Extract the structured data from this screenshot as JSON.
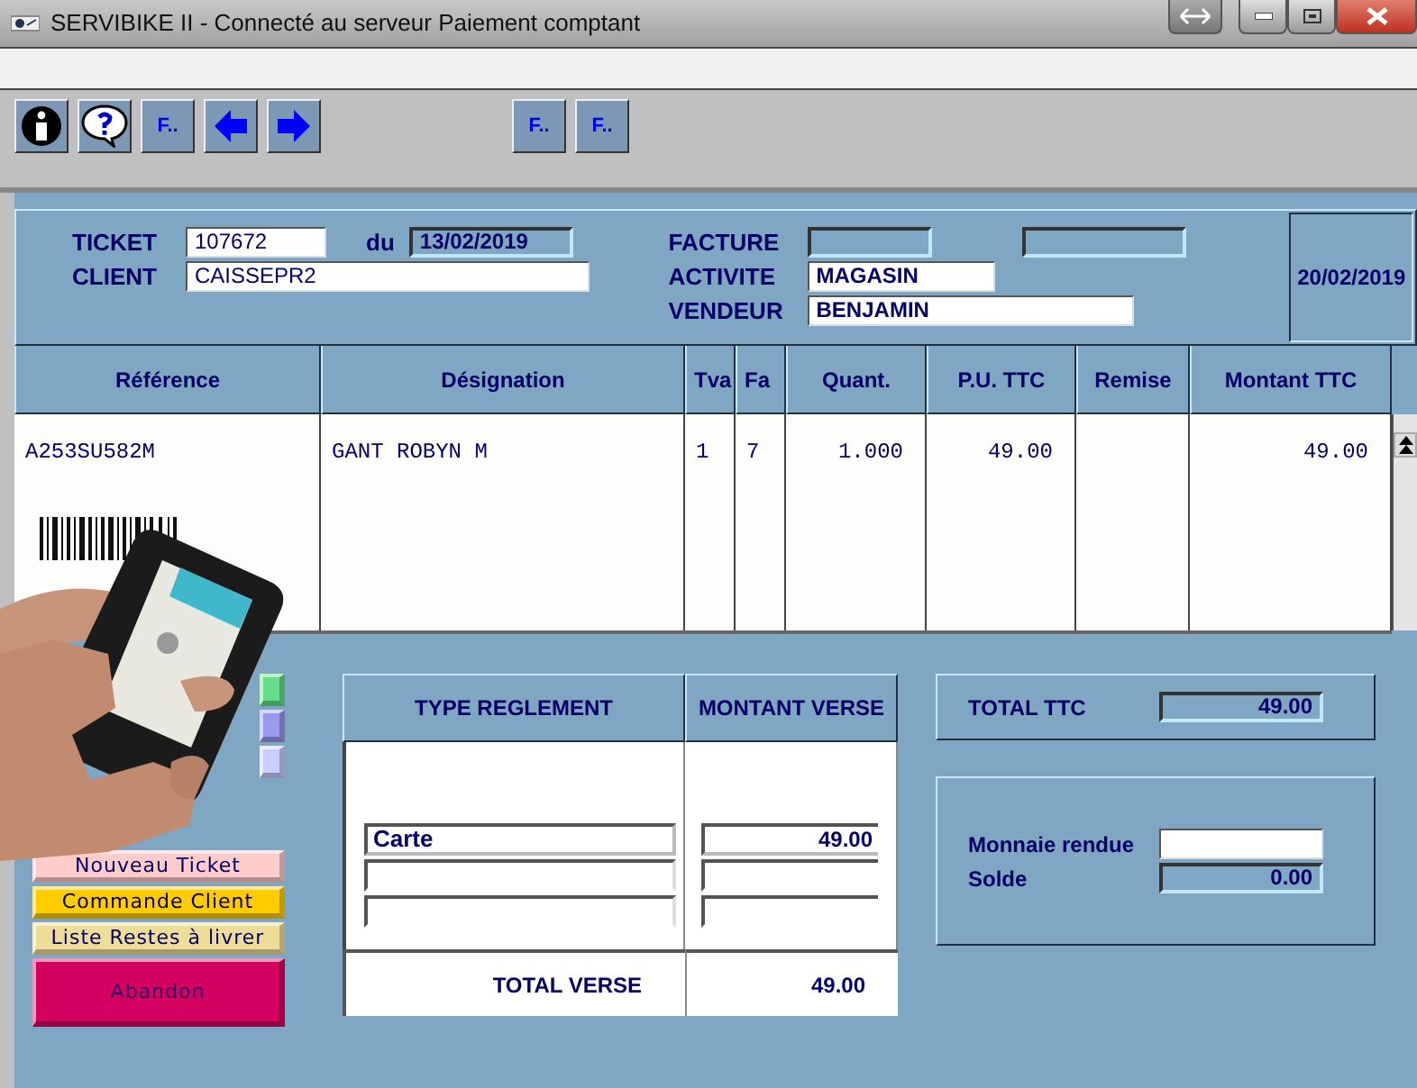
{
  "window": {
    "title": "SERVIBIKE II - Connecté au serveur Paiement comptant"
  },
  "toolbar": {
    "left": [
      {
        "kind": "info"
      },
      {
        "kind": "help"
      },
      {
        "kind": "text",
        "label": "F.."
      },
      {
        "kind": "prev"
      },
      {
        "kind": "next"
      }
    ],
    "right": [
      {
        "kind": "text",
        "label": "F.."
      },
      {
        "kind": "text",
        "label": "F.."
      }
    ]
  },
  "header": {
    "ticket": {
      "label": "TICKET",
      "value": "107672"
    },
    "date_label": "du",
    "date": "13/02/2019",
    "client": {
      "label": "CLIENT",
      "value": "CAISSEPR2"
    },
    "facture": {
      "label": "FACTURE"
    },
    "activite": {
      "label": "ACTIVITE",
      "value": "MAGASIN"
    },
    "vendeur": {
      "label": "VENDEUR",
      "value": "BENJAMIN"
    },
    "today": "20/02/2019"
  },
  "table": {
    "columns": [
      "Référence",
      "Désignation",
      "Tva",
      "Fa",
      "Quant.",
      "P.U. TTC",
      "Remise",
      "Montant TTC"
    ],
    "rows": [
      [
        "A253SU582M",
        "GANT ROBYN M",
        "1",
        "7",
        "1.000",
        "49.00",
        "",
        "49.00"
      ]
    ]
  },
  "buttons": [
    {
      "kind": "covered",
      "color": "#66dd88"
    },
    {
      "kind": "covered",
      "color": "#9999ee"
    },
    {
      "kind": "covered",
      "color": "#ccccff"
    },
    {
      "kind": "small",
      "label": "Nouveau Ticket",
      "color": "#ffcccc"
    },
    {
      "kind": "small",
      "label": "Commande Client",
      "color": "#ffcc00"
    },
    {
      "kind": "small",
      "label": "Liste Restes à livrer",
      "color": "#eedd99"
    },
    {
      "kind": "large",
      "label": "Abandon",
      "color": "#d40060"
    }
  ],
  "payment": {
    "columns": [
      "TYPE REGLEMENT",
      "MONTANT VERSE"
    ],
    "rows": [
      {
        "kind": "filled",
        "type": "Carte",
        "amount": "49.00"
      },
      {
        "kind": "empty"
      },
      {
        "kind": "empty"
      }
    ],
    "total_label": "TOTAL VERSE",
    "total": "49.00"
  },
  "total_ttc": {
    "label": "TOTAL TTC",
    "value": "49.00"
  },
  "change": {
    "label": "Monnaie rendue"
  },
  "solde": {
    "label": "Solde",
    "value": "0.00"
  }
}
